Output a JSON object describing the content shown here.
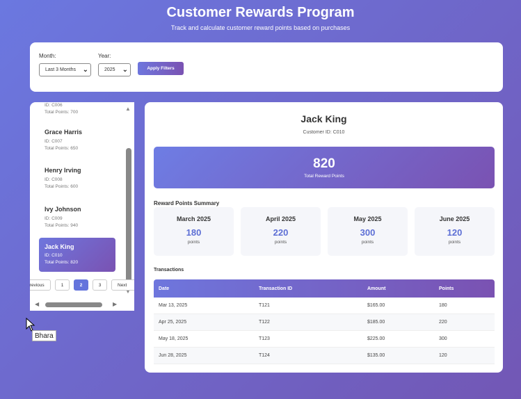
{
  "header": {
    "title": "Customer Rewards Program",
    "subtitle": "Track and calculate customer reward points based on purchases"
  },
  "filters": {
    "month_label": "Month:",
    "month_value": "Last 3 Months",
    "year_label": "Year:",
    "year_value": "2025",
    "apply_label": "Apply Filters"
  },
  "customers": [
    {
      "id": "ID: C006",
      "points": "Total Points: 700"
    },
    {
      "name": "Grace Harris",
      "id": "ID: C007",
      "points": "Total Points: 650"
    },
    {
      "name": "Henry Irving",
      "id": "ID: C008",
      "points": "Total Points: 600"
    },
    {
      "name": "Ivy Johnson",
      "id": "ID: C009",
      "points": "Total Points: 940"
    },
    {
      "name": "Jack King",
      "id": "ID: C010",
      "points": "Total Points: 820"
    }
  ],
  "pagination": {
    "previous": "Previous",
    "pages": [
      "1",
      "2",
      "3"
    ],
    "next": "Next",
    "current": "2"
  },
  "detail": {
    "name": "Jack King",
    "customer_id": "Customer ID: C010",
    "total_points": "820",
    "total_label": "Total Reward Points",
    "summary_title": "Reward Points Summary",
    "months": [
      {
        "month": "March 2025",
        "points": "180",
        "unit": "points"
      },
      {
        "month": "April 2025",
        "points": "220",
        "unit": "points"
      },
      {
        "month": "May 2025",
        "points": "300",
        "unit": "points"
      },
      {
        "month": "June 2025",
        "points": "120",
        "unit": "points"
      }
    ],
    "transactions_title": "Transactions",
    "columns": [
      "Date",
      "Transaction ID",
      "Amount",
      "Points"
    ],
    "rows": [
      [
        "Mar 13, 2025",
        "T121",
        "$165.00",
        "180"
      ],
      [
        "Apr 25, 2025",
        "T122",
        "$185.00",
        "220"
      ],
      [
        "May 18, 2025",
        "T123",
        "$225.00",
        "300"
      ],
      [
        "Jun 28, 2025",
        "T124",
        "$135.00",
        "120"
      ]
    ]
  },
  "tooltip": "Bhara",
  "colors": {
    "accent": "#6474dc",
    "accent_purple": "#7a52b2",
    "points_text": "#5d6fd5"
  }
}
